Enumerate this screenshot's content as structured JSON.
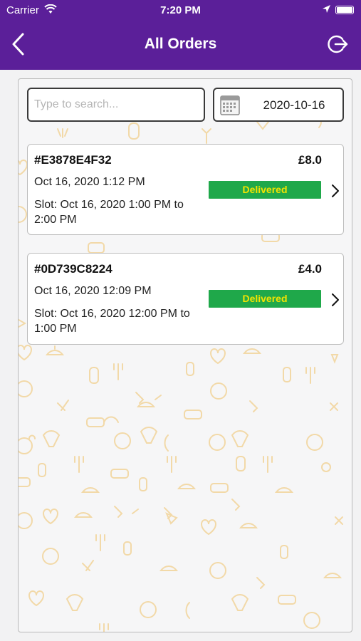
{
  "status_bar": {
    "carrier": "Carrier",
    "time": "7:20 PM",
    "icons": [
      "wifi-icon",
      "location-arrow-icon",
      "battery-icon"
    ]
  },
  "nav": {
    "title": "All Orders",
    "back_icon": "chevron-left-icon",
    "logout_icon": "logout-icon"
  },
  "search": {
    "placeholder": "Type to search...",
    "value": ""
  },
  "date_filter": {
    "value": "2020-10-16",
    "icon": "calendar-icon"
  },
  "orders": [
    {
      "id": "#E3878E4F32",
      "price": "£8.0",
      "date": "Oct 16, 2020 1:12 PM",
      "slot": "Slot: Oct 16, 2020 1:00 PM to 2:00 PM",
      "status": "Delivered"
    },
    {
      "id": "#0D739C8224",
      "price": "£4.0",
      "date": "Oct 16, 2020 12:09 PM",
      "slot": "Slot: Oct 16, 2020 12:00 PM to 1:00 PM",
      "status": "Delivered"
    }
  ],
  "colors": {
    "header": "#5b1f99",
    "status_badge_bg": "#1fa84a",
    "status_badge_text": "#f3e400",
    "background_doodles": "#f2d9a8"
  }
}
